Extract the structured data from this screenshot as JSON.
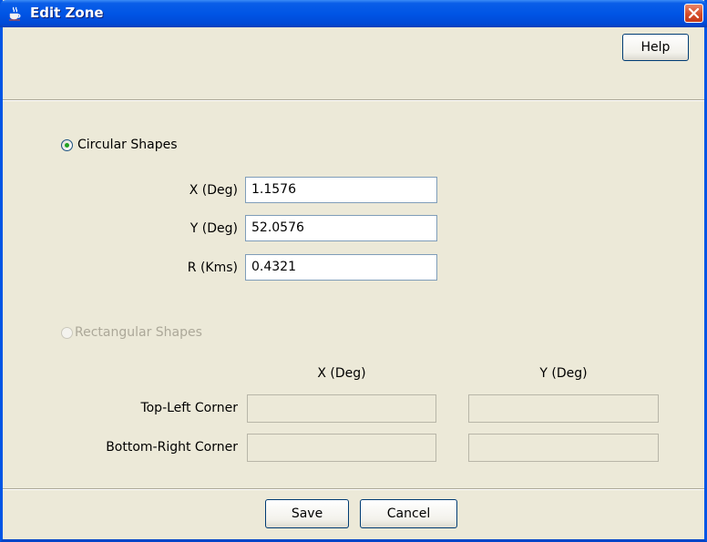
{
  "window": {
    "title": "Edit Zone",
    "icon": "java-coffee-cup-icon",
    "close_icon": "close-icon",
    "colors": {
      "titlebar": "#0055e5",
      "close": "#d54d29",
      "background": "#ece9d8"
    }
  },
  "toolbar": {
    "help_label": "Help"
  },
  "circular": {
    "label": "Circular Shapes",
    "selected": true,
    "fields": {
      "x_label": "X (Deg)",
      "x_value": "1.1576",
      "y_label": "Y (Deg)",
      "y_value": "52.0576",
      "r_label": "R (Kms)",
      "r_value": "0.4321"
    }
  },
  "rectangular": {
    "label": "Rectangular Shapes",
    "selected": false,
    "enabled": false,
    "col_x": "X (Deg)",
    "col_y": "Y (Deg)",
    "top_left_label": "Top-Left Corner",
    "bottom_right_label": "Bottom-Right Corner",
    "top_left_x": "",
    "top_left_y": "",
    "bottom_right_x": "",
    "bottom_right_y": ""
  },
  "footer": {
    "save_label": "Save",
    "cancel_label": "Cancel"
  }
}
